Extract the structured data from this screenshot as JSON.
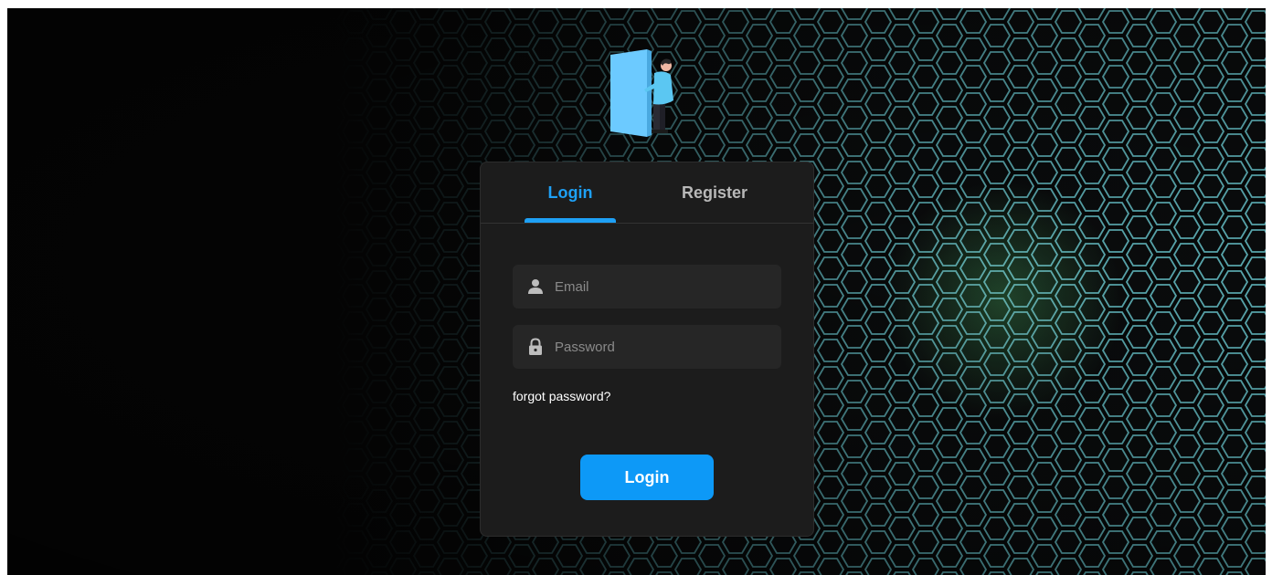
{
  "tabs": {
    "login_label": "Login",
    "register_label": "Register",
    "active": "login"
  },
  "form": {
    "email_placeholder": "Email",
    "email_value": "",
    "password_placeholder": "Password",
    "password_value": "",
    "forgot_label": "forgot password?",
    "submit_label": "Login"
  },
  "icons": {
    "email": "user-icon",
    "password": "lock-icon",
    "hero": "person-entering-door-illustration"
  },
  "colors": {
    "accent": "#1ea0f5",
    "button": "#0d99f7",
    "card": "#1c1c1c",
    "field": "#262626",
    "hex_edge": "#6fc2c9",
    "hex_glow": "#4fc36a"
  }
}
